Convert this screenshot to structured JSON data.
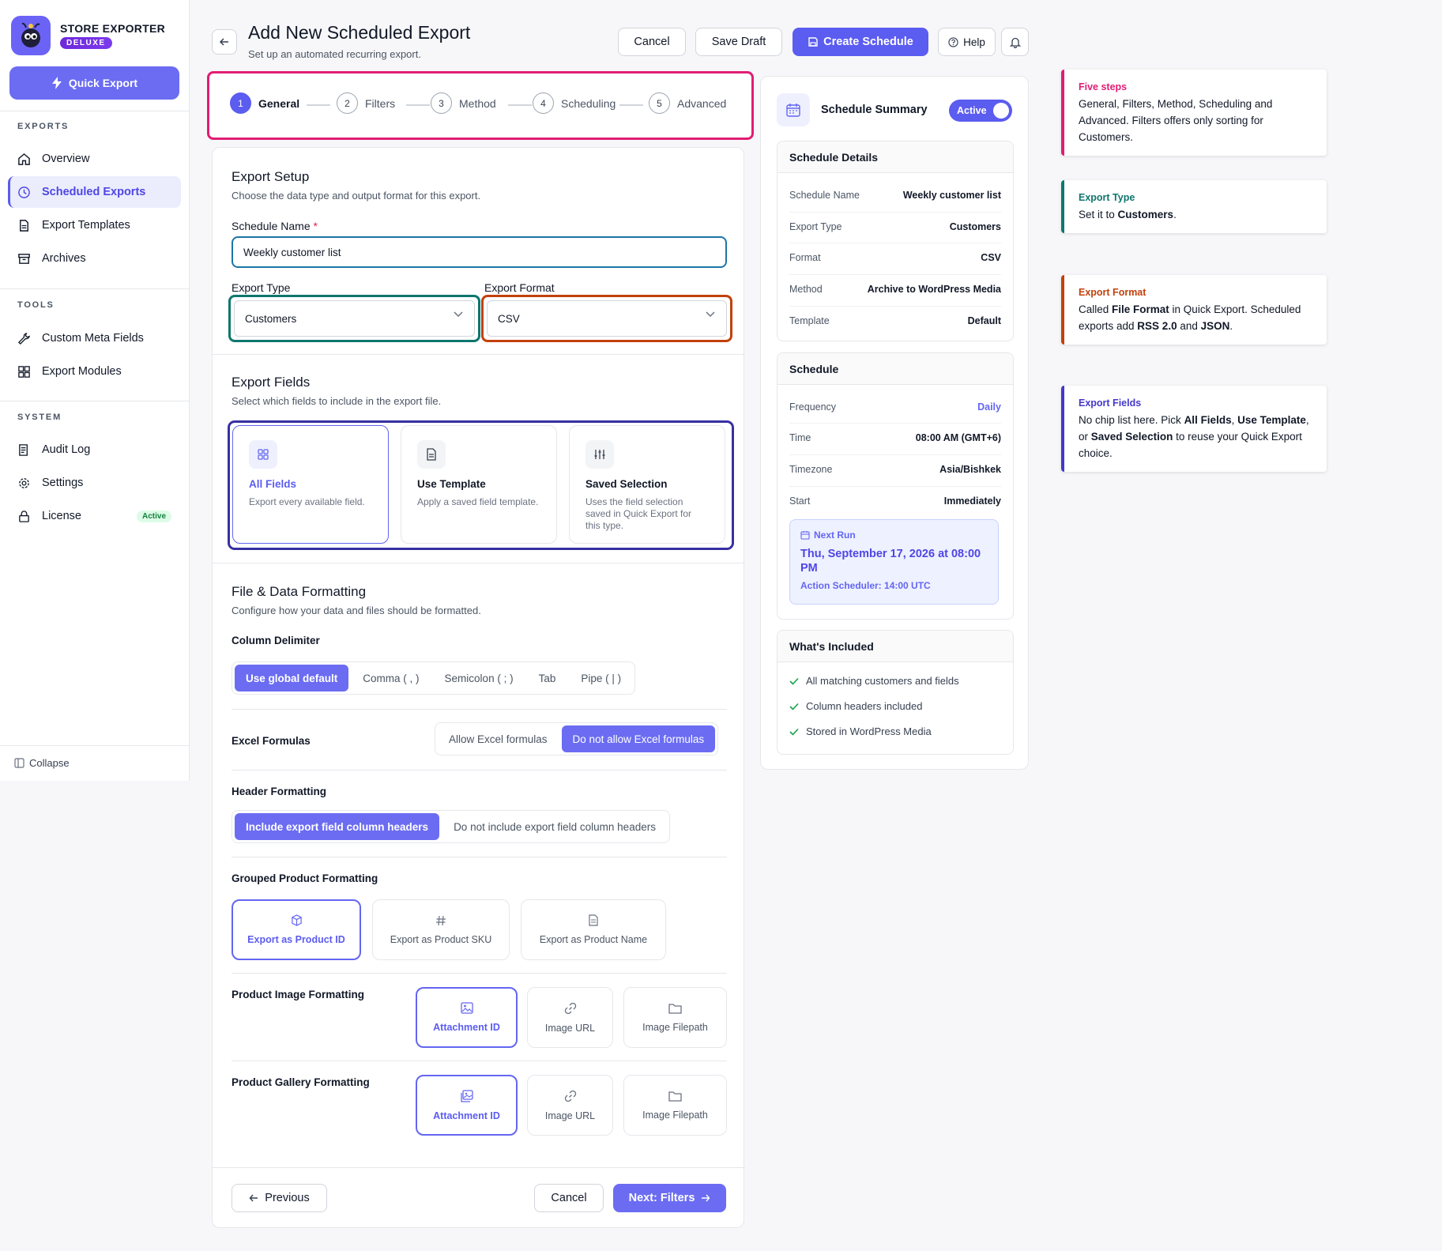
{
  "brand": {
    "name": "STORE EXPORTER",
    "badge": "DELUXE"
  },
  "sidebar": {
    "quick_export": "Quick Export",
    "exports_head": "EXPORTS",
    "tools_head": "TOOLS",
    "system_head": "SYSTEM",
    "items": [
      {
        "label": "Overview"
      },
      {
        "label": "Scheduled Exports"
      },
      {
        "label": "Export Templates"
      },
      {
        "label": "Archives"
      },
      {
        "label": "Custom Meta Fields"
      },
      {
        "label": "Export Modules"
      },
      {
        "label": "Audit Log"
      },
      {
        "label": "Settings"
      },
      {
        "label": "License"
      }
    ],
    "license_badge": "Active",
    "collapse": "Collapse"
  },
  "header": {
    "title": "Add New Scheduled Export",
    "subtitle": "Set up an automated recurring export.",
    "cancel": "Cancel",
    "save_draft": "Save Draft",
    "create": "Create Schedule",
    "help": "Help"
  },
  "steps": [
    {
      "num": "1",
      "label": "General"
    },
    {
      "num": "2",
      "label": "Filters"
    },
    {
      "num": "3",
      "label": "Method"
    },
    {
      "num": "4",
      "label": "Scheduling"
    },
    {
      "num": "5",
      "label": "Advanced"
    }
  ],
  "setup": {
    "title": "Export Setup",
    "subtitle": "Choose the data type and output format for this export.",
    "name_label": "Schedule Name",
    "required_mark": "*",
    "name_value": "Weekly customer list",
    "type_label": "Export Type",
    "type_value": "Customers",
    "format_label": "Export Format",
    "format_value": "CSV"
  },
  "fields": {
    "title": "Export Fields",
    "subtitle": "Select which fields to include in the export file.",
    "options": [
      {
        "title": "All Fields",
        "desc": "Export every available field."
      },
      {
        "title": "Use Template",
        "desc": "Apply a saved field template."
      },
      {
        "title": "Saved Selection",
        "desc": "Uses the field selection saved in Quick Export for this type."
      }
    ]
  },
  "formatting": {
    "title": "File & Data Formatting",
    "subtitle": "Configure how your data and files should be formatted.",
    "delimiter_label": "Column Delimiter",
    "delimiters": [
      "Use global default",
      "Comma ( , )",
      "Semicolon ( ; )",
      "Tab",
      "Pipe ( | )"
    ],
    "excel_label": "Excel Formulas",
    "excel_opts": [
      "Allow Excel formulas",
      "Do not allow Excel formulas"
    ],
    "header_label": "Header Formatting",
    "header_opts": [
      "Include export field column headers",
      "Do not include export field column headers"
    ],
    "grouped_label": "Grouped Product Formatting",
    "grouped_opts": [
      "Export as Product ID",
      "Export as Product SKU",
      "Export as Product Name"
    ],
    "image_label": "Product Image Formatting",
    "image_opts": [
      "Attachment ID",
      "Image URL",
      "Image Filepath"
    ],
    "gallery_label": "Product Gallery Formatting",
    "gallery_opts": [
      "Attachment ID",
      "Image URL",
      "Image Filepath"
    ]
  },
  "footer": {
    "previous": "Previous",
    "cancel": "Cancel",
    "next": "Next: Filters"
  },
  "summary": {
    "title": "Schedule Summary",
    "toggle": "Active",
    "details_head": "Schedule Details",
    "details": [
      {
        "k": "Schedule Name",
        "v": "Weekly customer list"
      },
      {
        "k": "Export Type",
        "v": "Customers"
      },
      {
        "k": "Format",
        "v": "CSV"
      },
      {
        "k": "Method",
        "v": "Archive to WordPress Media"
      },
      {
        "k": "Template",
        "v": "Default"
      }
    ],
    "schedule_head": "Schedule",
    "schedule": [
      {
        "k": "Frequency",
        "v": "Daily"
      },
      {
        "k": "Time",
        "v": "08:00 AM (GMT+6)"
      },
      {
        "k": "Timezone",
        "v": "Asia/Bishkek"
      },
      {
        "k": "Start",
        "v": "Immediately"
      }
    ],
    "next_run_label": "Next Run",
    "next_run_date": "Thu, September 17, 2026 at 08:00 PM",
    "next_run_sub": "Action Scheduler: 14:00 UTC",
    "included_head": "What's Included",
    "included": [
      "All matching customers and fields",
      "Column headers included",
      "Stored in WordPress Media"
    ]
  },
  "annotations": [
    {
      "title": "Five steps",
      "color": "#e11d74",
      "parts": [
        "General, Filters, Method, Scheduling and Advanced. Filters offers only sorting for Customers."
      ]
    },
    {
      "title": "Export Type",
      "color": "#0f766e",
      "parts": [
        "Set it to ",
        "Customers",
        "."
      ]
    },
    {
      "title": "Export Format",
      "color": "#c2410c",
      "parts": [
        "Called ",
        "File Format",
        " in Quick Export. Scheduled exports add ",
        "RSS 2.0",
        " and ",
        "JSON",
        "."
      ]
    },
    {
      "title": "Export Fields",
      "color": "#4338ca",
      "parts": [
        "No chip list here. Pick ",
        "All Fields",
        ", ",
        "Use Template",
        ", or ",
        "Saved Selection",
        " to reuse your Quick Export choice."
      ]
    }
  ],
  "colors": {
    "accent": "#5b5cf0",
    "steps_outline": "#e11d74",
    "type_outline": "#0f766e",
    "format_outline": "#c2410c",
    "fields_outline": "#3730a3"
  }
}
